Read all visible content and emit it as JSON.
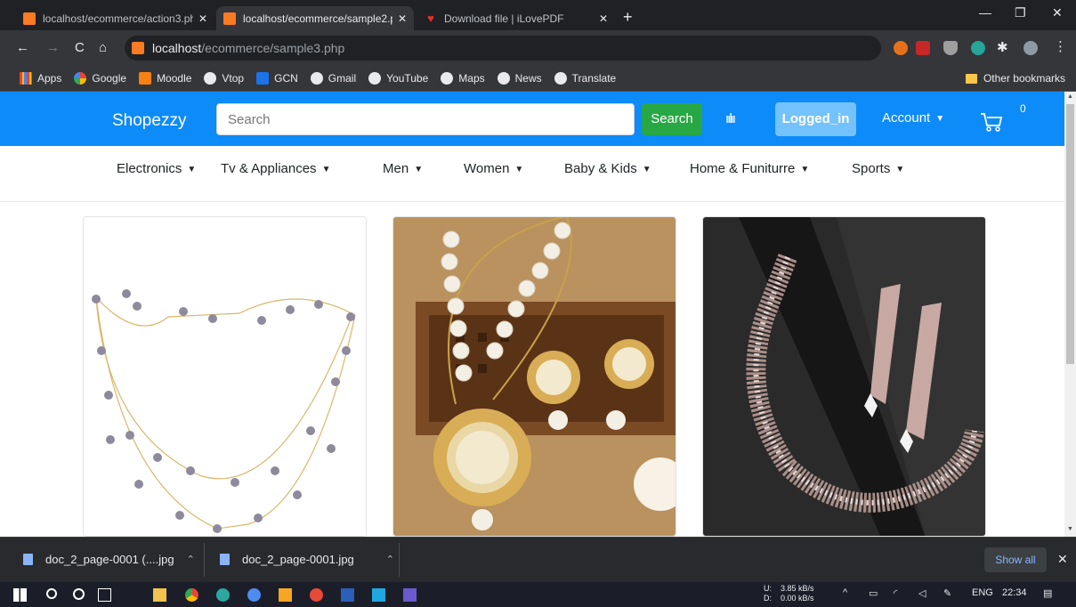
{
  "browser": {
    "tabs": [
      {
        "title": "localhost/ecommerce/action3.ph",
        "active": false
      },
      {
        "title": "localhost/ecommerce/sample2.p",
        "active": true
      },
      {
        "title": "Download file | iLovePDF",
        "active": false
      }
    ],
    "url_host": "localhost",
    "url_path": "/ecommerce/sample3.php",
    "bookmarks": [
      "Apps",
      "Google",
      "Moodle",
      "Vtop",
      "GCN",
      "Gmail",
      "YouTube",
      "Maps",
      "News",
      "Translate"
    ],
    "other_bookmarks": "Other bookmarks"
  },
  "site": {
    "brand": "Shopezzy",
    "search_placeholder": "Search",
    "search_button": "Search",
    "logged_in_button": "Logged_in",
    "account_label": "Account",
    "cart_count": "0",
    "categories": [
      "Electronics",
      "Tv & Appliances",
      "Men",
      "Women",
      "Baby & Kids",
      "Home & Funiturre",
      "Sports"
    ]
  },
  "products": [
    {
      "image": "pearl-layered-necklace-image"
    },
    {
      "image": "pearl-pendant-jewellery-set-image"
    },
    {
      "image": "diamond-necklace-set-image"
    }
  ],
  "downloads": {
    "items": [
      "doc_2_page-0001 (....jpg",
      "doc_2_page-0001.jpg"
    ],
    "show_all": "Show all"
  },
  "taskbar": {
    "upload_label": "U:",
    "download_label": "D:",
    "upload_speed": "3.85 kB/s",
    "download_speed": "0.00 kB/s",
    "language": "ENG",
    "time": "22:34"
  },
  "colors": {
    "navbar": "#0d8bf9",
    "search_button": "#28a745",
    "logged_in_button": "#74c2fb"
  }
}
